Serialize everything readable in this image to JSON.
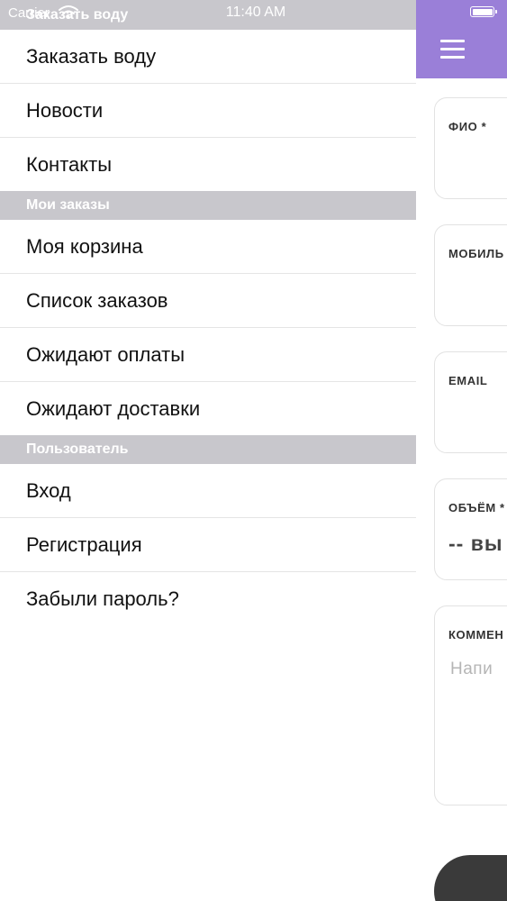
{
  "status_bar": {
    "carrier": "Carrier",
    "time": "11:40 AM",
    "overlay_title": "Заказать воду"
  },
  "drawer": {
    "sections": [
      {
        "header": "",
        "items": [
          "Заказать воду",
          "Новости",
          "Контакты"
        ]
      },
      {
        "header": "Мои заказы",
        "items": [
          "Моя корзина",
          "Список заказов",
          "Ожидают оплаты",
          "Ожидают доставки"
        ]
      },
      {
        "header": "Пользователь",
        "items": [
          "Вход",
          "Регистрация",
          "Забыли пароль?"
        ]
      }
    ]
  },
  "form": {
    "fields": [
      {
        "label": "ФИО *",
        "value": ""
      },
      {
        "label": "МОБИЛЬ",
        "value": ""
      },
      {
        "label": "EMAIL",
        "value": ""
      },
      {
        "label": "ОБЪЁМ *",
        "value": "-- вы"
      },
      {
        "label": "КОММЕН",
        "placeholder": "Напи"
      }
    ]
  },
  "colors": {
    "header_purple": "#9a7fd8",
    "section_gray": "#c8c7cc",
    "submit_dark": "#3a3a3a"
  },
  "icons": {
    "menu": "hamburger-icon",
    "wifi": "wifi-icon",
    "battery": "battery-icon"
  }
}
